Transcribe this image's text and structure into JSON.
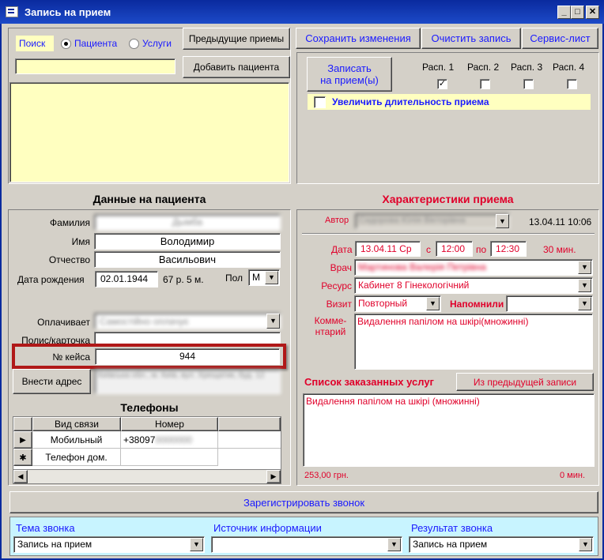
{
  "window": {
    "title": "Запись на прием",
    "minimize": "_",
    "maximize": "□",
    "close": "✕"
  },
  "search": {
    "label": "Поиск",
    "opt_patients": "Пациента",
    "opt_services": "Услуги",
    "prev_appointments": "Предыдущие приемы",
    "add_patient": "Добавить пациента",
    "value": ""
  },
  "toolbar": {
    "save": "Сохранить изменения",
    "clear": "Очистить запись",
    "service_sheet": "Сервис-лист"
  },
  "schedule": {
    "book_line1": "Записать",
    "book_line2": "на прием(ы)",
    "slots": [
      "Расп. 1",
      "Расп. 2",
      "Расп. 3",
      "Расп. 4"
    ],
    "extend": "Увеличить длительность приема"
  },
  "patient": {
    "section_title": "Данные на пациента",
    "surname_label": "Фамилия",
    "surname_value": "Дымба",
    "name_label": "Имя",
    "name_value": "Володимир",
    "patronymic_label": "Отчество",
    "patronymic_value": "Васильович",
    "dob_label": "Дата рождения",
    "dob_value": "02.01.1944",
    "age": "67 р. 5 м.",
    "sex_label": "Пол",
    "sex_value": "М",
    "payer_label": "Оплачивает",
    "payer_value": "Самостійно оплачує",
    "policy_label": "Полис/карточка",
    "policy_value": "",
    "case_label": "№ кейса",
    "case_value": "944",
    "address_button": "Внести адрес",
    "address_value": "Київська обл., м. Київ, вул. Хрещатик, буд. 12"
  },
  "phones": {
    "title": "Телефоны",
    "col_type": "Вид связи",
    "col_number": "Номер",
    "rows": [
      {
        "marker": "▶",
        "type": "Мобильный",
        "number": "+38097",
        "number_hidden": "0000000"
      },
      {
        "marker": "✱",
        "type": "Телефон дом.",
        "number": "",
        "number_hidden": ""
      }
    ]
  },
  "appointment": {
    "section_title": "Характеристики приема",
    "author_label": "Автор",
    "author_value": "Сидорова Юлія Вікторівна",
    "created": "13.04.11 10:06",
    "date_label": "Дата",
    "date_value": "13.04.11 Ср",
    "from_label": "с",
    "from_value": "12:00",
    "to_label": "по",
    "to_value": "12:30",
    "duration": "30 мин.",
    "doctor_label": "Врач",
    "doctor_value": "Мартинова Валерія Петрівна",
    "resource_label": "Ресурс",
    "resource_value": "Кабинет 8 Гінекологічний",
    "visit_label": "Визит",
    "visit_value": "Повторный",
    "remind_label": "Напомнили",
    "remind_value": "",
    "comment_label1": "Комме-",
    "comment_label2": "нтарий",
    "comment_value": "Видалення папілом на шкірі(множинні)",
    "services_title": "Список заказанных услуг",
    "from_prev": "Из предыдущей записи",
    "services_value": "Видалення папілом на шкірі (множинні)",
    "total_price": "253,00 грн.",
    "total_time": "0 мин."
  },
  "call": {
    "register": "Зарегистрировать звонок",
    "topic_label": "Тема звонка",
    "topic_value": "Запись на прием",
    "source_label": "Источник информации",
    "source_value": "",
    "result_label": "Результат звонка",
    "result_value": "Запись на прием"
  },
  "colors": {
    "title_bar": "#0a2a9e",
    "highlight_frame": "#b01818",
    "field_yellow": "#ffffc0",
    "call_panel": "#c8f4ff"
  }
}
